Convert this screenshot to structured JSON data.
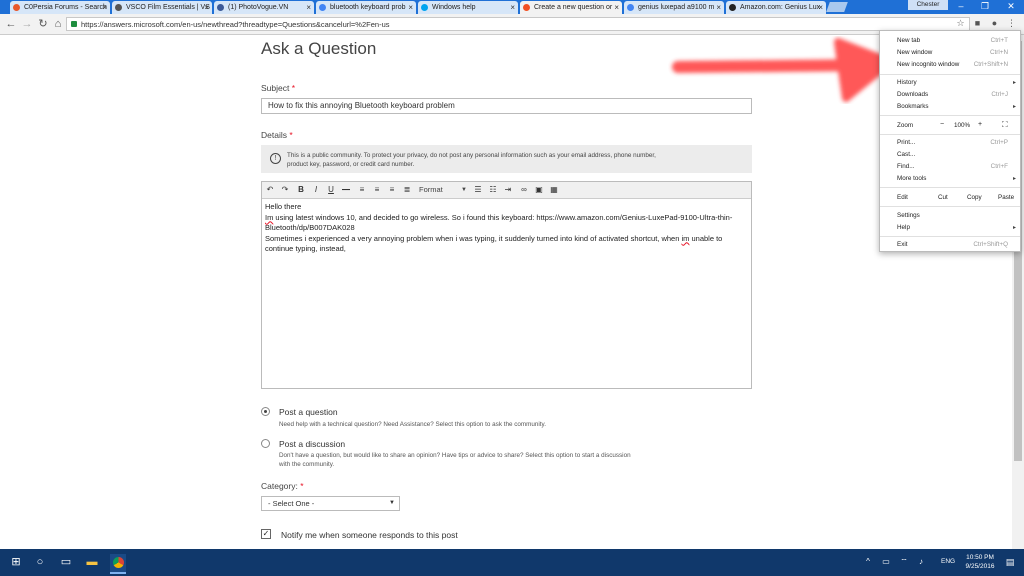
{
  "browser": {
    "tabs": [
      {
        "label": "C0Persia Forums - Search",
        "color": "#e8572a"
      },
      {
        "label": "VSCO Film Essentials | VS",
        "color": "#555555"
      },
      {
        "label": "(1) PhotoVogue.VN",
        "color": "#3b5998"
      },
      {
        "label": "bluetooth keyboard prob",
        "color": "#4285f4"
      },
      {
        "label": "Windows help",
        "color": "#00a4ef"
      },
      {
        "label": "Create a new question or",
        "color": "#f25022"
      },
      {
        "label": "genius luxepad a9100 m",
        "color": "#4285f4"
      },
      {
        "label": "Amazon.com: Genius Lux",
        "color": "#222222"
      }
    ],
    "profile": "Chester",
    "url": "https://answers.microsoft.com/en-us/newthread?threadtype=Questions&cancelurl=%2Fen-us"
  },
  "page": {
    "title": "Ask a Question",
    "subject_label": "Subject",
    "subject_value": "How to fix this annoying Bluetooth keyboard problem",
    "details_label": "Details",
    "required_mark": "*",
    "notice_text": "This is a public community. To protect your privacy, do not post any personal information such as your email address, phone number, product key, password, or credit card number.",
    "format_label": "Format",
    "editor": {
      "line1": "Hello there",
      "line2_a": "Im",
      "line2_b": " using latest windows 10, and decided to go wireless. So i found this keyboard: https://www.amazon.com/Genius-LuxePad-9100-Ultra-thin-Bluetooth/dp/B007DAK028",
      "line3_a": "Sometimes i experienced a very annoying problem when i was typing, it suddenly turned into kind of activated shortcut, when ",
      "line3_b": "im",
      "line3_c": " unable to continue typing, instead,"
    },
    "post_question_label": "Post a question",
    "post_question_desc": "Need help with a technical question? Need Assistance? Select this option to ask the community.",
    "post_discussion_label": "Post a discussion",
    "post_discussion_desc": "Don't have a question, but would like to share an opinion? Have tips or advice to share? Select this option to start a discussion with the community.",
    "category_label": "Category:",
    "category_value": "- Select One -",
    "notify_label": "Notify me when someone responds to this post"
  },
  "menu": {
    "new_tab": "New tab",
    "new_tab_sc": "Ctrl+T",
    "new_window": "New window",
    "new_window_sc": "Ctrl+N",
    "incognito": "New incognito window",
    "incognito_sc": "Ctrl+Shift+N",
    "history": "History",
    "downloads": "Downloads",
    "downloads_sc": "Ctrl+J",
    "bookmarks": "Bookmarks",
    "zoom": "Zoom",
    "zoom_minus": "−",
    "zoom_level": "100%",
    "zoom_plus": "+",
    "print": "Print...",
    "print_sc": "Ctrl+P",
    "cast": "Cast...",
    "find": "Find...",
    "find_sc": "Ctrl+F",
    "more_tools": "More tools",
    "edit": "Edit",
    "cut": "Cut",
    "copy": "Copy",
    "paste": "Paste",
    "settings": "Settings",
    "help": "Help",
    "exit": "Exit",
    "exit_sc": "Ctrl+Shift+Q"
  },
  "taskbar": {
    "lang": "ENG",
    "time": "10:50 PM",
    "date": "9/25/2016"
  },
  "colors": {
    "accent": "#1f70d6",
    "taskbar": "#10386b",
    "annotation": "#ff3a3a"
  }
}
